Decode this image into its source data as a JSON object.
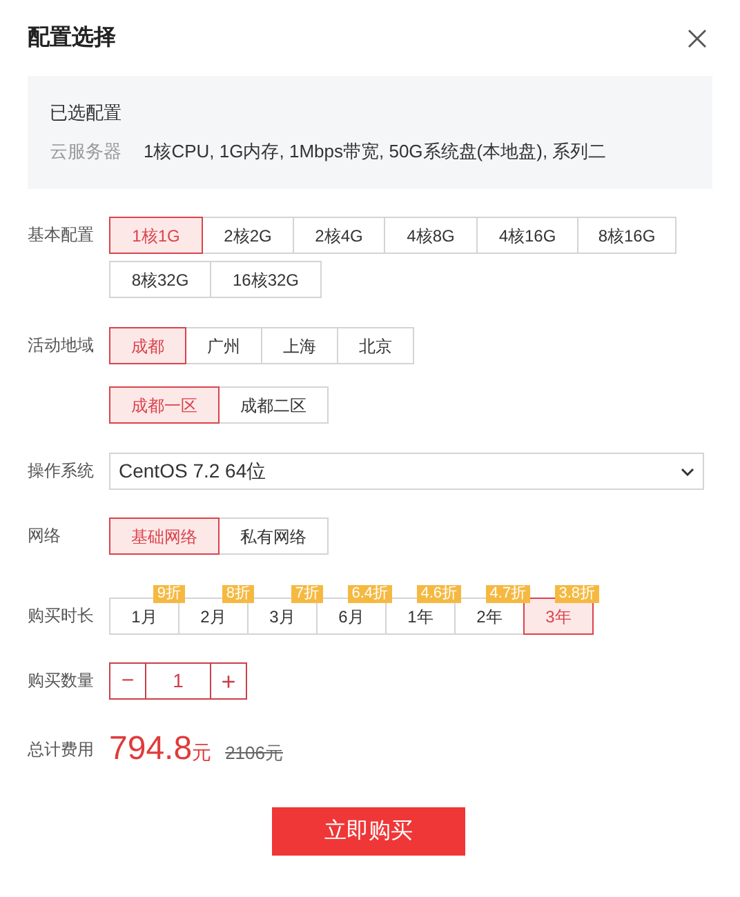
{
  "dialog": {
    "title": "配置选择"
  },
  "summary": {
    "heading": "已选配置",
    "label": "云服务器",
    "value": "1核CPU, 1G内存, 1Mbps带宽, 50G系统盘(本地盘), 系列二"
  },
  "basic": {
    "label": "基本配置",
    "options": [
      {
        "label": "1核1G",
        "selected": true
      },
      {
        "label": "2核2G",
        "selected": false
      },
      {
        "label": "2核4G",
        "selected": false
      },
      {
        "label": "4核8G",
        "selected": false
      },
      {
        "label": "4核16G",
        "selected": false
      },
      {
        "label": "8核16G",
        "selected": false
      },
      {
        "label": "8核32G",
        "selected": false
      },
      {
        "label": "16核32G",
        "selected": false
      }
    ]
  },
  "region": {
    "label": "活动地域",
    "options": [
      {
        "label": "成都",
        "selected": true
      },
      {
        "label": "广州",
        "selected": false
      },
      {
        "label": "上海",
        "selected": false
      },
      {
        "label": "北京",
        "selected": false
      }
    ],
    "zones": [
      {
        "label": "成都一区",
        "selected": true
      },
      {
        "label": "成都二区",
        "selected": false
      }
    ]
  },
  "os": {
    "label": "操作系统",
    "value": "CentOS 7.2 64位"
  },
  "network": {
    "label": "网络",
    "options": [
      {
        "label": "基础网络",
        "selected": true
      },
      {
        "label": "私有网络",
        "selected": false
      }
    ]
  },
  "duration": {
    "label": "购买时长",
    "options": [
      {
        "label": "1月",
        "badge": "9折",
        "selected": false
      },
      {
        "label": "2月",
        "badge": "8折",
        "selected": false
      },
      {
        "label": "3月",
        "badge": "7折",
        "selected": false
      },
      {
        "label": "6月",
        "badge": "6.4折",
        "selected": false
      },
      {
        "label": "1年",
        "badge": "4.6折",
        "selected": false
      },
      {
        "label": "2年",
        "badge": "4.7折",
        "selected": false
      },
      {
        "label": "3年",
        "badge": "3.8折",
        "selected": true
      }
    ]
  },
  "quantity": {
    "label": "购买数量",
    "minus": "−",
    "value": "1",
    "plus": "+"
  },
  "total": {
    "label": "总计费用",
    "price": "794.8",
    "unit": "元",
    "original": "2106元"
  },
  "buy_button": "立即购买"
}
